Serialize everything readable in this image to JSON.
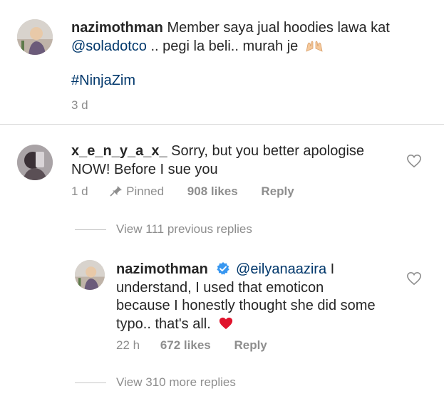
{
  "post_caption": {
    "username": "nazimothman",
    "text_main": "Member saya jual hoodies lawa kat",
    "mention": "@soladotco",
    "text_after": " .. pegi la beli.. murah je",
    "emoji": "raised-hands-emoji",
    "hashtag": "#NinjaZim",
    "timestamp": "3 d"
  },
  "comment": {
    "username": "x_e_n_y_a_x_",
    "text_line1": " Sorry, but you better apologise",
    "text_line2": "NOW! Before I sue you",
    "timestamp": "1 d",
    "pinned_label": "Pinned",
    "likes": "908 likes",
    "reply_label": "Reply"
  },
  "view_previous": {
    "label": "View 111 previous replies"
  },
  "reply": {
    "username": "nazimothman",
    "mention": "@eilyanaazira",
    "text_after_mention": " I",
    "line2": "understand, I used that emoticon",
    "line3": "because I honestly thought she did some",
    "line4": "typo.. that's all.",
    "timestamp": "22 h",
    "likes": "672 likes",
    "reply_label": "Reply"
  },
  "view_more": {
    "label": "View 310 more replies"
  },
  "colors": {
    "link": "#00376b",
    "muted": "#8e8e8e",
    "verified": "#3897f0",
    "heart": "#ed4956"
  }
}
